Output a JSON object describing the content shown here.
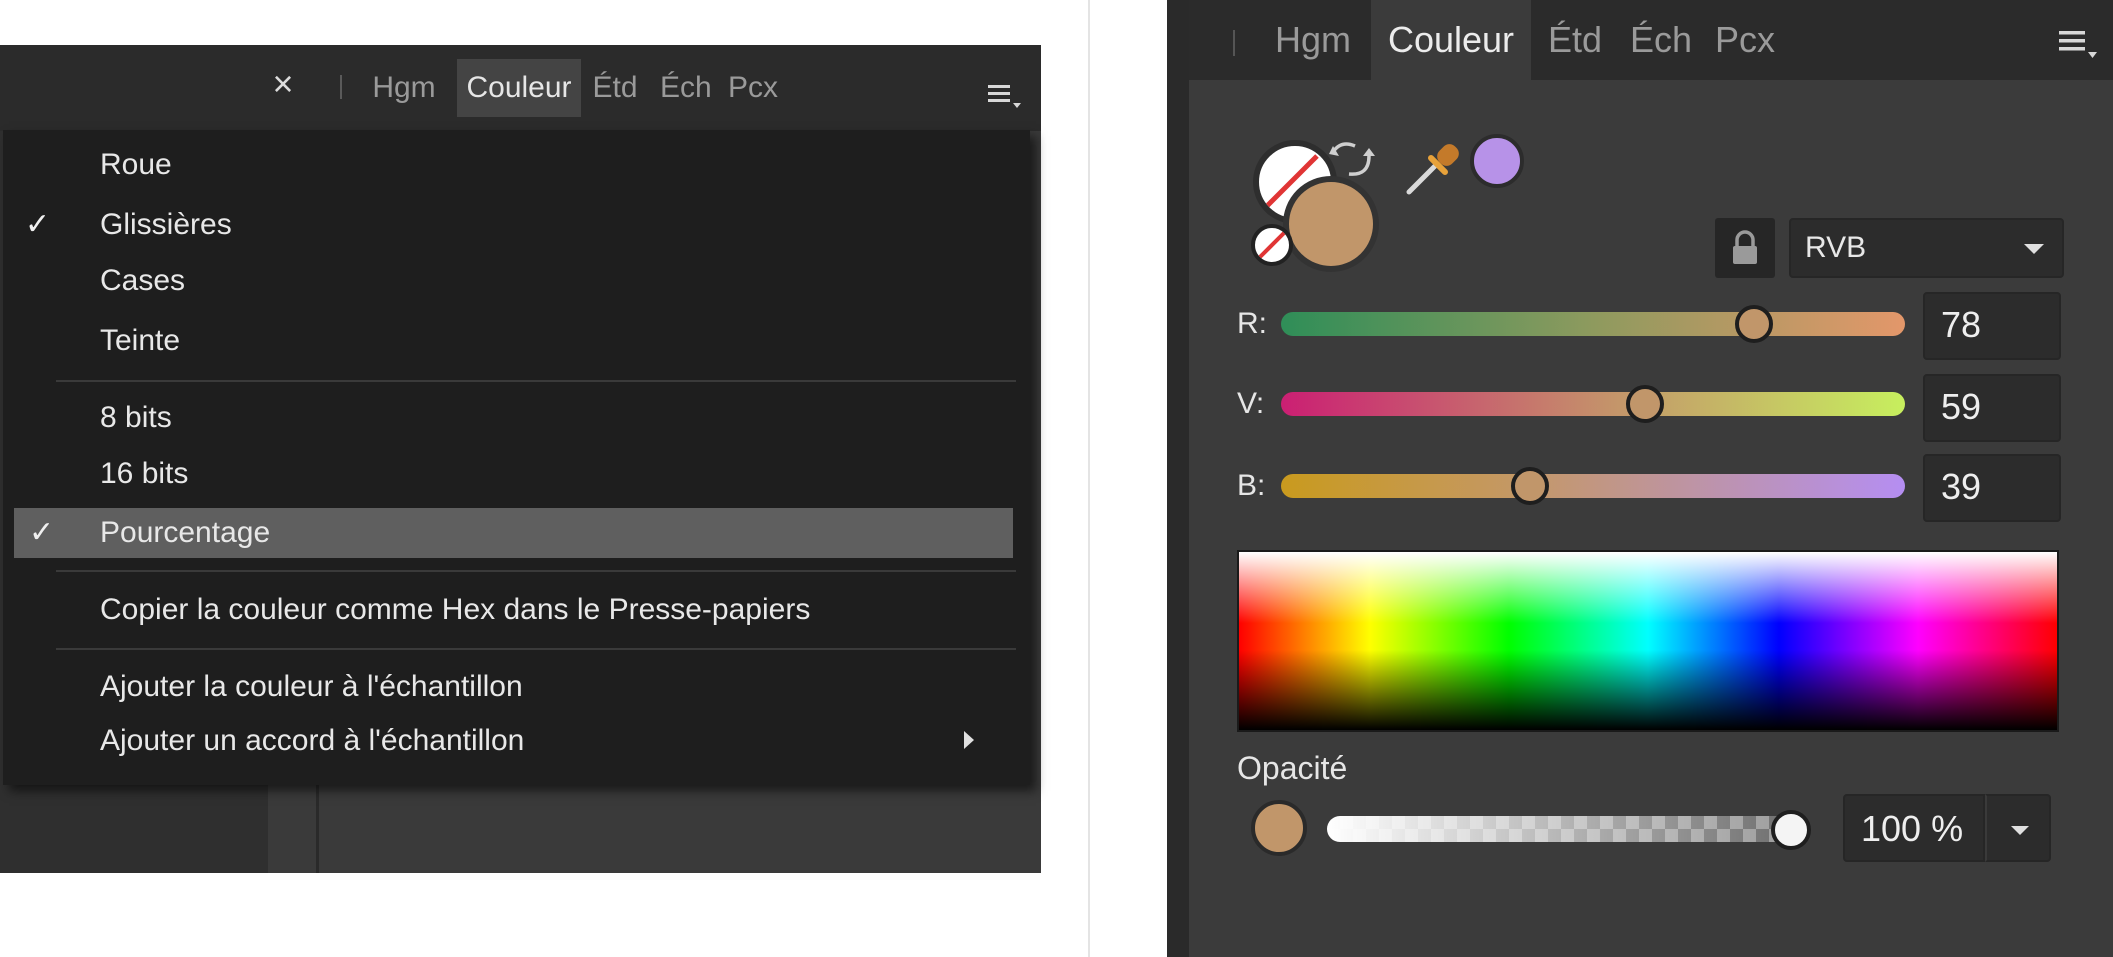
{
  "colors": {
    "fill": "#c1966a",
    "picked": "#b792e8",
    "stroke_none_line": "#e03535"
  },
  "left_panel": {
    "close_icon": "×",
    "tabs": [
      {
        "label": "Hgm",
        "active": false
      },
      {
        "label": "Couleur",
        "active": true
      },
      {
        "label": "Étd",
        "active": false
      },
      {
        "label": "Éch",
        "active": false
      },
      {
        "label": "Pcx",
        "active": false
      }
    ],
    "menu_icon": "panel-menu-icon"
  },
  "context_menu": {
    "items": [
      {
        "label": "Roue",
        "checked": false
      },
      {
        "label": "Glissières",
        "checked": true
      },
      {
        "label": "Cases",
        "checked": false
      },
      {
        "label": "Teinte",
        "checked": false
      },
      {
        "label": "8 bits",
        "checked": false
      },
      {
        "label": "16 bits",
        "checked": false
      },
      {
        "label": "Pourcentage",
        "checked": true,
        "highlighted": true
      },
      {
        "label": "Copier la couleur comme Hex dans le Presse-papiers",
        "checked": false
      },
      {
        "label": "Ajouter la couleur à l'échantillon",
        "checked": false
      },
      {
        "label": "Ajouter un accord à l'échantillon",
        "checked": false,
        "submenu": true
      }
    ],
    "check_glyph": "✓"
  },
  "right_panel": {
    "tabs": [
      {
        "label": "Hgm",
        "active": false
      },
      {
        "label": "Couleur",
        "active": true
      },
      {
        "label": "Étd",
        "active": false
      },
      {
        "label": "Éch",
        "active": false
      },
      {
        "label": "Pcx",
        "active": false
      }
    ],
    "color_model": "RVB",
    "sliders": [
      {
        "label": "R:",
        "value": "78",
        "level": 0.78
      },
      {
        "label": "V:",
        "value": "59",
        "level": 0.59
      },
      {
        "label": "B:",
        "value": "39",
        "level": 0.39
      }
    ],
    "opacity": {
      "label": "Opacité",
      "value": "100 %",
      "level": 1.0
    }
  }
}
